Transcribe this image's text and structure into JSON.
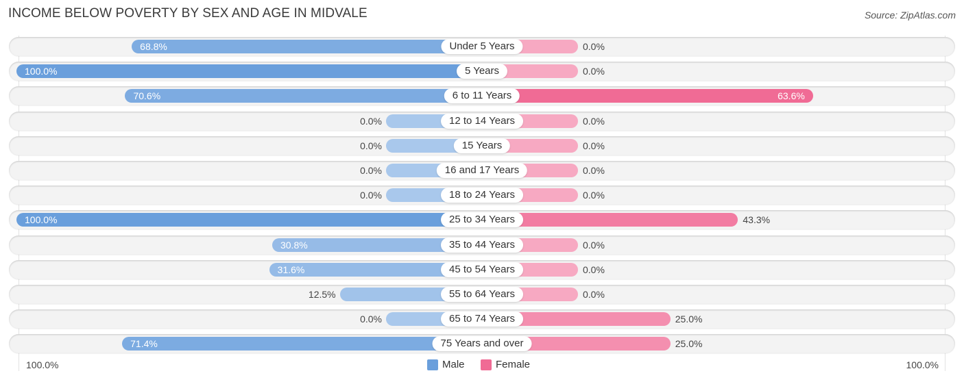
{
  "chart_data": {
    "type": "bar",
    "orientation": "horizontal-diverging",
    "title": "INCOME BELOW POVERTY BY SEX AND AGE IN MIDVALE",
    "source": "Source: ZipAtlas.com",
    "categories": [
      "Under 5 Years",
      "5 Years",
      "6 to 11 Years",
      "12 to 14 Years",
      "15 Years",
      "16 and 17 Years",
      "18 to 24 Years",
      "25 to 34 Years",
      "35 to 44 Years",
      "45 to 54 Years",
      "55 to 64 Years",
      "65 to 74 Years",
      "75 Years and over"
    ],
    "series": [
      {
        "name": "Male",
        "color": "#6a9fdc",
        "values": [
          68.8,
          100.0,
          70.6,
          0.0,
          0.0,
          0.0,
          0.0,
          100.0,
          30.8,
          31.6,
          12.5,
          0.0,
          71.4
        ],
        "labels": [
          "68.8%",
          "100.0%",
          "70.6%",
          "0.0%",
          "0.0%",
          "0.0%",
          "0.0%",
          "100.0%",
          "30.8%",
          "31.6%",
          "12.5%",
          "0.0%",
          "71.4%"
        ]
      },
      {
        "name": "Female",
        "color": "#f06b95",
        "values": [
          0.0,
          0.0,
          63.6,
          0.0,
          0.0,
          0.0,
          0.0,
          43.3,
          0.0,
          0.0,
          0.0,
          25.0,
          25.0
        ],
        "labels": [
          "0.0%",
          "0.0%",
          "63.6%",
          "0.0%",
          "0.0%",
          "0.0%",
          "0.0%",
          "43.3%",
          "0.0%",
          "0.0%",
          "0.0%",
          "25.0%",
          "25.0%"
        ]
      }
    ],
    "xlim": [
      -100,
      100
    ],
    "axis_labels": {
      "left": "100.0%",
      "right": "100.0%"
    },
    "legend": {
      "position": "bottom-center",
      "items": [
        "Male",
        "Female"
      ]
    },
    "grid": false
  },
  "colors": {
    "male_strong": "#6a9fdc",
    "male_light": "#a9c8ec",
    "female_strong": "#f06b95",
    "female_light": "#f7a9c2"
  }
}
